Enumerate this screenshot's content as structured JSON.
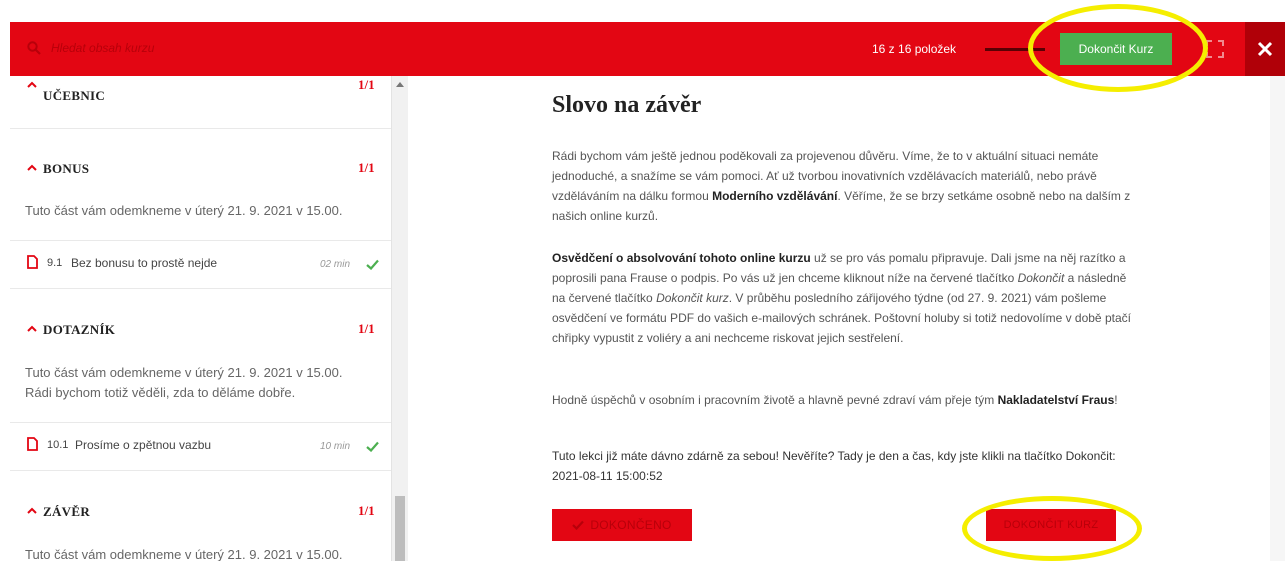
{
  "topbar": {
    "search_placeholder": "Hledat obsah kurzu",
    "items_count": "16 z 16 položek",
    "progress_fraction": 1.0,
    "finish_course_label": "Dokončit Kurz",
    "close_symbol": "✕"
  },
  "sidebar": {
    "sections": [
      {
        "title": "UČEBNIC",
        "count": "1/1"
      },
      {
        "title": "BONUS",
        "count": "1/1",
        "description": "Tuto část vám odemkneme v úterý 21. 9. 2021 v 15.00.",
        "lessons": [
          {
            "number": "9.1",
            "title": "Bez bonusu to prostě nejde",
            "duration": "02 min"
          }
        ]
      },
      {
        "title": "DOTAZNÍK",
        "count": "1/1",
        "description_line1": "Tuto část vám odemkneme v úterý 21. 9. 2021 v 15.00.",
        "description_line2": "Rádi bychom totiž věděli, zda to děláme dobře.",
        "lessons": [
          {
            "number": "10.1",
            "title": "Prosíme o zpětnou vazbu",
            "duration": "10 min"
          }
        ]
      },
      {
        "title": "ZÁVĚR",
        "count": "1/1",
        "description": "Tuto část vám odemkneme v úterý 21. 9. 2021 v 15.00."
      }
    ]
  },
  "main": {
    "title": "Slovo na závěr",
    "p1": {
      "text_a": "Rádi bychom vám ještě jednou poděkovali za projevenou důvěru. Víme, že to v aktuální situaci nemáte jednoduché, a snažíme se vám pomoci. Ať už tvorbou inovativních vzdělávacích materiálů, nebo právě vzděláváním na dálku formou ",
      "bold": "Moderního vzdělávání",
      "text_b": ". Věříme, že se brzy setkáme osobně nebo na dalším z našich online kurzů."
    },
    "p2": {
      "bold": "Osvědčení o absolvování tohoto online kurzu",
      "text_a": " už se pro vás pomalu připravuje. Dali jsme na něj razítko a poprosili pana Frause o podpis. Po vás už jen chceme kliknout níže na červené tlačítko ",
      "italic_a": "Dokončit",
      "text_b": " a následně na červené tlačítko ",
      "italic_b": "Dokončit kurz",
      "text_c": ". V průběhu posledního zářijového týdne (od 27. 9. 2021) vám pošleme osvědčení ve formátu PDF do vašich e-mailových schránek. Poštovní holuby si totiž nedovolíme v době ptačí chřipky vypustit z voliéry a ani nechceme riskovat jejich sestřelení."
    },
    "p3": {
      "text_a": "Hodně úspěchů v osobním i pracovním životě a hlavně pevné zdraví vám přeje tým ",
      "bold": "Nakladatelství Fraus",
      "text_b": "!"
    },
    "p4": "Tuto lekci již máte dávno zdárně za sebou! Nevěříte? Tady je den a čas, kdy jste klikli na tlačítko Dokončit: 2021-08-11 15:00:52",
    "done_label": "DOKONČENO",
    "finish_course_label": "DOKONČIT KURZ"
  },
  "colors": {
    "brand_red": "#e30613",
    "dark_red": "#b00008",
    "green": "#4caf50",
    "highlight_yellow": "#f5ee00"
  },
  "icons": [
    "search-icon",
    "fullscreen-icon",
    "close-icon",
    "chevron-up-icon",
    "document-icon",
    "check-icon"
  ]
}
